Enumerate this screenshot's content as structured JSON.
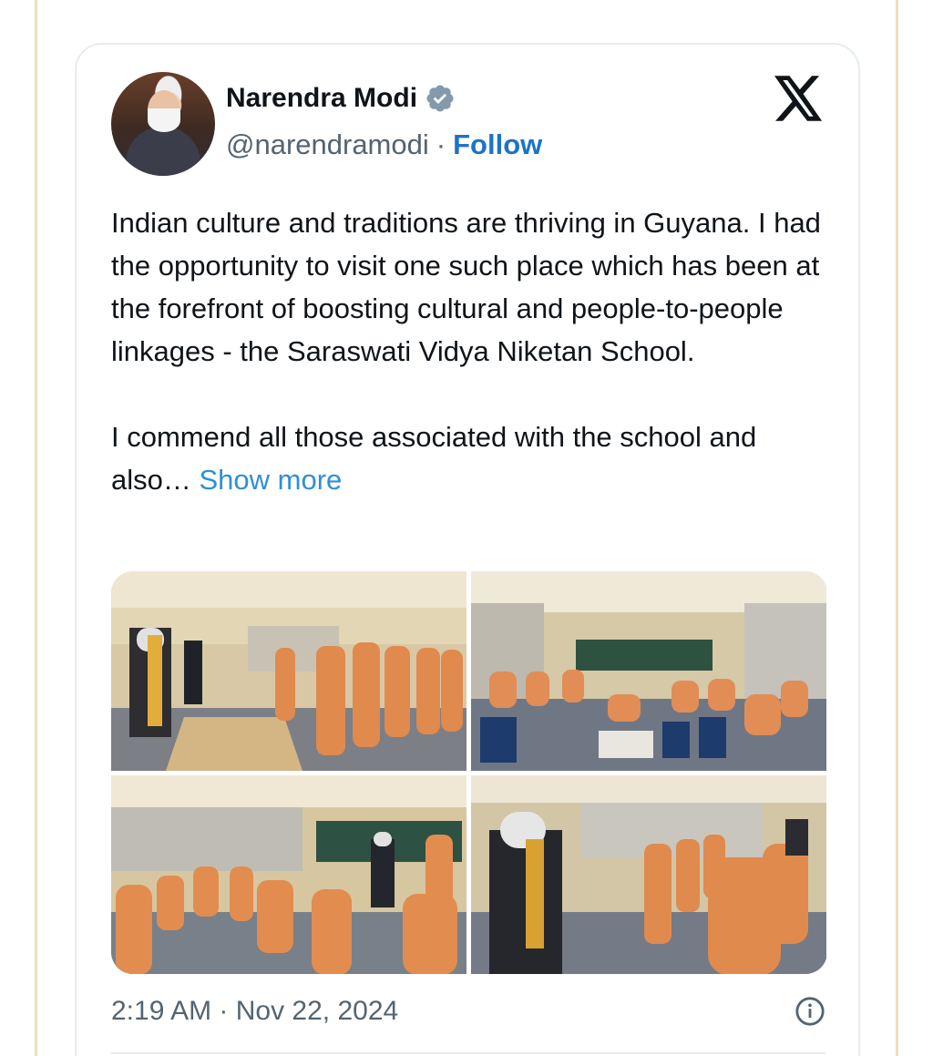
{
  "tweet": {
    "author": {
      "name": "Narendra Modi",
      "handle": "@narendramodi",
      "verified": true,
      "verified_color": "#829aab"
    },
    "separator": "·",
    "follow_label": "Follow",
    "follow_color": "#1d73c9",
    "platform_logo": "x-logo-icon",
    "text_main": "Indian culture and traditions are thriving in Guyana. I had the opportunity to visit one such place which has been at the forefront of boosting cultural and people-to-people linkages - the Saraswati Vidya Niketan School.\n\nI commend all those associated with the school and also…",
    "show_more_label": "Show more",
    "show_more_color": "#2f8fd8",
    "media_count": 4,
    "timestamp": "2:19 AM · Nov 22, 2024",
    "info_icon": "info-icon"
  }
}
